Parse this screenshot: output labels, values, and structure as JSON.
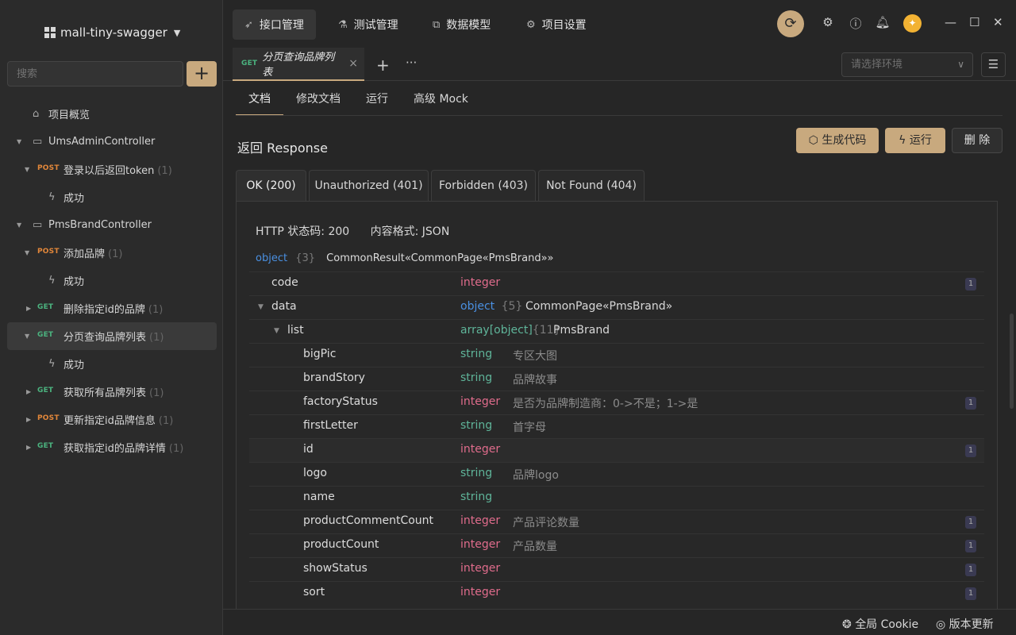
{
  "sidebar": {
    "project_name": "mall-tiny-swagger",
    "search_placeholder": "搜索",
    "add_label": "+",
    "overview_label": "项目概览",
    "tree": [
      {
        "label": "UmsAdminController"
      },
      {
        "method": "POST",
        "label": "登录以后返回token",
        "count": "(1)"
      },
      {
        "label": "成功"
      },
      {
        "label": "PmsBrandController"
      },
      {
        "method": "POST",
        "label": "添加品牌",
        "count": "(1)"
      },
      {
        "label": "成功"
      },
      {
        "method": "GET",
        "label": "删除指定id的品牌",
        "count": "(1)"
      },
      {
        "method": "GET",
        "label": "分页查询品牌列表",
        "count": "(1)"
      },
      {
        "label": "成功"
      },
      {
        "method": "GET",
        "label": "获取所有品牌列表",
        "count": "(1)"
      },
      {
        "method": "POST",
        "label": "更新指定id品牌信息",
        "count": "(1)"
      },
      {
        "method": "GET",
        "label": "获取指定id的品牌详情",
        "count": "(1)"
      }
    ]
  },
  "topnav": {
    "tabs": [
      "接口管理",
      "测试管理",
      "数据模型",
      "项目设置"
    ]
  },
  "doc": {
    "tab_method": "GET",
    "tab_title": "分页查询品牌列表",
    "env_placeholder": "请选择环境",
    "subtabs": [
      "文档",
      "修改文档",
      "运行",
      "高级 Mock"
    ]
  },
  "response": {
    "title": "返回 Response",
    "buttons": {
      "gen": "生成代码",
      "run": "运行",
      "del": "删 除"
    },
    "status_tabs": [
      "OK (200)",
      "Unauthorized (401)",
      "Forbidden (403)",
      "Not Found (404)"
    ],
    "status_code": "HTTP 状态码: 200",
    "content_type": "内容格式: JSON",
    "root": {
      "type": "object",
      "count": "{3}",
      "name": "CommonResult«CommonPage«PmsBrand»»"
    },
    "fields": [
      {
        "name": "code",
        "type": "integer",
        "desc": "",
        "badge": "1"
      },
      {
        "name": "data",
        "type": "object",
        "count": "{5}",
        "desc": "CommonPage«PmsBrand»",
        "badge": ""
      },
      {
        "name": "list",
        "type": "array[object]",
        "count": "{11}",
        "desc": "PmsBrand",
        "badge": ""
      },
      {
        "name": "bigPic",
        "type": "string",
        "desc": "专区大图",
        "badge": ""
      },
      {
        "name": "brandStory",
        "type": "string",
        "desc": "品牌故事",
        "badge": ""
      },
      {
        "name": "factoryStatus",
        "type": "integer",
        "desc": "是否为品牌制造商：0->不是；1->是",
        "badge": "1"
      },
      {
        "name": "firstLetter",
        "type": "string",
        "desc": "首字母",
        "badge": ""
      },
      {
        "name": "id",
        "type": "integer",
        "desc": "",
        "badge": "1"
      },
      {
        "name": "logo",
        "type": "string",
        "desc": "品牌logo",
        "badge": ""
      },
      {
        "name": "name",
        "type": "string",
        "desc": "",
        "badge": ""
      },
      {
        "name": "productCommentCount",
        "type": "integer",
        "desc": "产品评论数量",
        "badge": "1"
      },
      {
        "name": "productCount",
        "type": "integer",
        "desc": "产品数量",
        "badge": "1"
      },
      {
        "name": "showStatus",
        "type": "integer",
        "desc": "",
        "badge": "1"
      },
      {
        "name": "sort",
        "type": "integer",
        "desc": "",
        "badge": "1"
      }
    ]
  },
  "footer": {
    "cookie": "全局 Cookie",
    "update": "版本更新"
  }
}
